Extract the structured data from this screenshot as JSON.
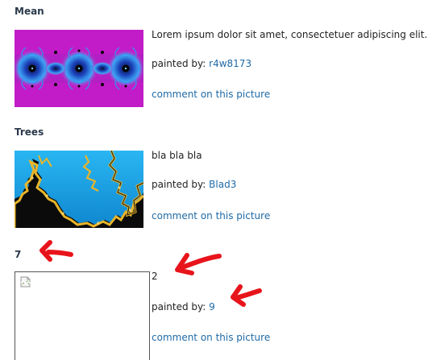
{
  "entries": [
    {
      "title": "Mean",
      "description": "Lorem ipsum dolor sit amet, consectetuer adipiscing elit.",
      "painted_by_label": "painted by:",
      "painter": "r4w8173",
      "comment_link": "comment on this picture",
      "image": "fractal-mandelbrot-magenta"
    },
    {
      "title": "Trees",
      "description": "bla bla bla",
      "painted_by_label": "painted by:",
      "painter": "Blad3",
      "comment_link": "comment on this picture",
      "image": "fractal-blue-yellow-trees"
    },
    {
      "title": "7",
      "description": "2",
      "painted_by_label": "painted by:",
      "painter": "9",
      "comment_link": "comment on this picture",
      "image": "broken-image-icon"
    }
  ],
  "annotation_color": "#e8141b"
}
